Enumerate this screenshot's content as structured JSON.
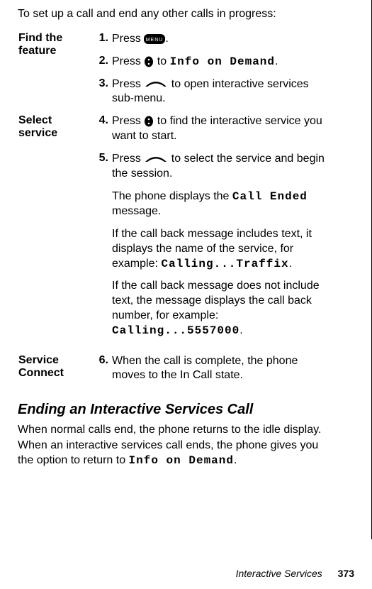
{
  "intro": "To set up a call and end any other calls in progress:",
  "sections": [
    {
      "label_l1": "Find the",
      "label_l2": "feature",
      "rows": [
        {
          "num": "1.",
          "pre": "Press ",
          "icon": "menu",
          "post": "."
        },
        {
          "num": "2.",
          "pre": "Press ",
          "icon": "scroll",
          "post_pre": " to ",
          "mono": "Info on Demand",
          "post": "."
        },
        {
          "num": "3.",
          "pre": "Press ",
          "icon": "send",
          "post": " to open interactive services sub-menu."
        }
      ]
    },
    {
      "label_l1": "Select",
      "label_l2": "service",
      "rows": [
        {
          "num": "4.",
          "pre": "Press ",
          "icon": "scroll",
          "post": " to find the interactive service you want to start."
        },
        {
          "num": "5.",
          "pre": "Press ",
          "icon": "send",
          "post": " to select the service and begin the session."
        }
      ],
      "extras": [
        {
          "pre": "The phone displays the ",
          "mono": "Call Ended",
          "post": " message."
        },
        {
          "pre": "If the call back message includes text, it displays the name of the service, for example: ",
          "mono": "Calling...Traffix",
          "post": "."
        },
        {
          "pre": "If the call back message does not include text, the message displays the call back number, for example: ",
          "mono": "Calling...5557000",
          "post": "."
        }
      ]
    },
    {
      "label_l1": "Service",
      "label_l2": "Connect",
      "rows": [
        {
          "num": "6.",
          "text": "When the call is complete, the phone moves to the In Call state."
        }
      ]
    }
  ],
  "heading": "Ending an Interactive Services Call",
  "ending_pre": "When normal calls end, the phone returns to the idle display. When an interactive services call ends, the phone gives you the option to return to ",
  "ending_mono": "Info on Demand",
  "ending_post": ".",
  "footer_title": "Interactive Services",
  "footer_page": "373"
}
